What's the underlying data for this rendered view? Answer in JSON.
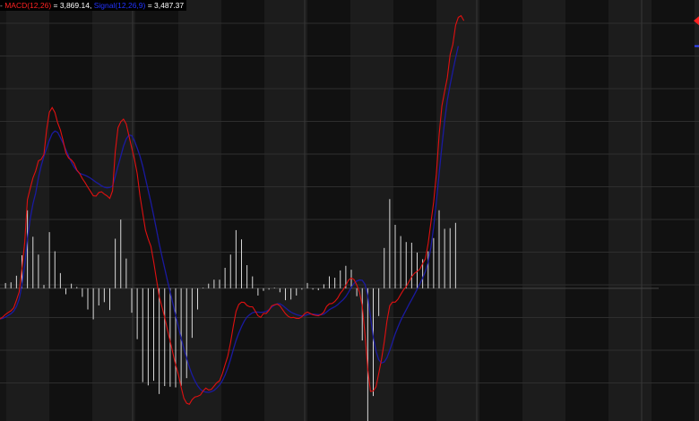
{
  "legend": {
    "macd_label": "MACD(12,26)",
    "macd_value": "3,869.14",
    "signal_label": "Signal(12,26,9)",
    "signal_value": "3,487.37",
    "separator": ", ",
    "prefix": "- ",
    "equals": " = "
  },
  "colors": {
    "background": "#141414",
    "band_light": "#1c1c1c",
    "band_dark": "#111111",
    "grid": "#2e2e2e",
    "macd": "#e01010",
    "signal": "#1a1aa0",
    "histogram": "#d8d8d8",
    "zero_line": "#444444",
    "marker": "#ff2020"
  },
  "chart_data": {
    "type": "line",
    "title": "",
    "xlabel": "",
    "ylabel": "",
    "ylim": [
      -3800,
      8400
    ],
    "grid": true,
    "legend_position": "top-left",
    "x": [
      0,
      1,
      2,
      3,
      4,
      5,
      6,
      7,
      8,
      9,
      10,
      11,
      12,
      13,
      14,
      15,
      16,
      17,
      18,
      19,
      20,
      21,
      22,
      23,
      24,
      25,
      26,
      27,
      28,
      29,
      30,
      31,
      32,
      33,
      34,
      35,
      36,
      37,
      38,
      39,
      40,
      41,
      42,
      43,
      44,
      45,
      46,
      47,
      48,
      49,
      50,
      51,
      52,
      53,
      54,
      55,
      56,
      57,
      58,
      59,
      60,
      61,
      62,
      63,
      64,
      65,
      66,
      67,
      68,
      69,
      70,
      71,
      72,
      73,
      74,
      75,
      76,
      77,
      78,
      79,
      80,
      81,
      82,
      83,
      84,
      85,
      86,
      87,
      88,
      89,
      90,
      91,
      92,
      93,
      94,
      95,
      96,
      97,
      98,
      99,
      100,
      101,
      102,
      103,
      104,
      105,
      106,
      107,
      108,
      109,
      110,
      111,
      112,
      113,
      114,
      115,
      116,
      117,
      118,
      119,
      120,
      121,
      122,
      123,
      124,
      125,
      126,
      127,
      128,
      129,
      130,
      131,
      132,
      133,
      134,
      135,
      136,
      137,
      138,
      139,
      140,
      141,
      142,
      143,
      144,
      145,
      146,
      147,
      148,
      149,
      150,
      151,
      152,
      153,
      154,
      155,
      156,
      157,
      158,
      159,
      160,
      161,
      162,
      163,
      164,
      165,
      166,
      167,
      168,
      169,
      170,
      171,
      172,
      173,
      174,
      175,
      176,
      177,
      178,
      179,
      180,
      181,
      182,
      183,
      184,
      185,
      186,
      187,
      188,
      189,
      190,
      191,
      192,
      193,
      194,
      195,
      196,
      197,
      198,
      199,
      200,
      201,
      202,
      203,
      204,
      205,
      206,
      207,
      208,
      209,
      210,
      211,
      212,
      213,
      214,
      215,
      216,
      217,
      218,
      219,
      220,
      221,
      222,
      223,
      224,
      225,
      226,
      227,
      228,
      229,
      230,
      231,
      232,
      233,
      234,
      235,
      236,
      237,
      238,
      239,
      240
    ],
    "series": [
      {
        "name": "MACD(12,26)",
        "values": [
          -930,
          -870,
          -790,
          -730,
          -680,
          -590,
          -360,
          -110,
          600,
          1400,
          2680,
          3020,
          3340,
          3550,
          3860,
          3900,
          4050,
          4810,
          5330,
          5470,
          5320,
          5010,
          4790,
          4470,
          4100,
          3940,
          3890,
          3780,
          3580,
          3480,
          3320,
          3200,
          3060,
          2930,
          2800,
          2790,
          2900,
          2920,
          2850,
          2800,
          2720,
          2950,
          4130,
          4860,
          5040,
          5120,
          4970,
          4610,
          4250,
          3900,
          3470,
          2800,
          2270,
          1760,
          1490,
          1270,
          800,
          270,
          -240,
          -560,
          -880,
          -1250,
          -1600,
          -1960,
          -2320,
          -2620,
          -2990,
          -3330,
          -3480,
          -3510,
          -3370,
          -3290,
          -3270,
          -3230,
          -3110,
          -3020,
          -3080,
          -3060,
          -2960,
          -2860,
          -2800,
          -2590,
          -2320,
          -2050,
          -1640,
          -1150,
          -700,
          -490,
          -420,
          -430,
          -520,
          -560,
          -560,
          -690,
          -830,
          -880,
          -760,
          -760,
          -670,
          -530,
          -500,
          -480,
          -530,
          -650,
          -770,
          -850,
          -890,
          -880,
          -910,
          -910,
          -860,
          -770,
          -720,
          -760,
          -800,
          -820,
          -830,
          -790,
          -720,
          -550,
          -470,
          -460,
          -400,
          -300,
          -150,
          -50,
          90,
          250,
          310,
          260,
          100,
          -120,
          -550,
          -1400,
          -2450,
          -3120,
          -3110,
          -2980,
          -2580,
          -2150,
          -1620,
          -990,
          -530,
          -420,
          -420,
          -330,
          -190,
          -50,
          50,
          200,
          350,
          450,
          510,
          580,
          750,
          890,
          1360,
          1980,
          2610,
          3450,
          4640,
          5520,
          5950,
          6380,
          7070,
          7380,
          7960,
          8200,
          8250,
          8100
        ]
      },
      {
        "name": "Signal(12,26,9)",
        "values": [
          -930,
          -910,
          -870,
          -820,
          -770,
          -690,
          -550,
          -330,
          100,
          700,
          1500,
          2100,
          2560,
          2880,
          3350,
          3700,
          4000,
          4240,
          4480,
          4680,
          4760,
          4720,
          4560,
          4390,
          4190,
          4000,
          3820,
          3670,
          3560,
          3480,
          3450,
          3420,
          3380,
          3330,
          3270,
          3210,
          3160,
          3100,
          3060,
          3040,
          3050,
          3100,
          3380,
          3700,
          4000,
          4300,
          4520,
          4640,
          4620,
          4460,
          4240,
          4000,
          3690,
          3330,
          2960,
          2600,
          2200,
          1780,
          1360,
          970,
          600,
          240,
          -110,
          -460,
          -820,
          -1170,
          -1510,
          -1830,
          -2120,
          -2390,
          -2620,
          -2800,
          -2950,
          -3060,
          -3120,
          -3140,
          -3150,
          -3130,
          -3090,
          -3020,
          -2930,
          -2800,
          -2630,
          -2410,
          -2150,
          -1860,
          -1580,
          -1360,
          -1160,
          -990,
          -870,
          -800,
          -740,
          -720,
          -720,
          -730,
          -720,
          -700,
          -650,
          -570,
          -510,
          -470,
          -470,
          -520,
          -590,
          -660,
          -720,
          -760,
          -800,
          -820,
          -840,
          -820,
          -800,
          -780,
          -780,
          -790,
          -800,
          -800,
          -780,
          -720,
          -650,
          -600,
          -560,
          -500,
          -420,
          -350,
          -250,
          -120,
          30,
          150,
          220,
          250,
          240,
          120,
          -230,
          -860,
          -1480,
          -1900,
          -2160,
          -2260,
          -2230,
          -2100,
          -1880,
          -1640,
          -1380,
          -1170,
          -980,
          -810,
          -650,
          -490,
          -340,
          -190,
          -30,
          140,
          310,
          510,
          800,
          1230,
          1850,
          2620,
          3460,
          4300,
          5050,
          5700,
          6160,
          6570,
          6970,
          7330
        ]
      }
    ]
  }
}
